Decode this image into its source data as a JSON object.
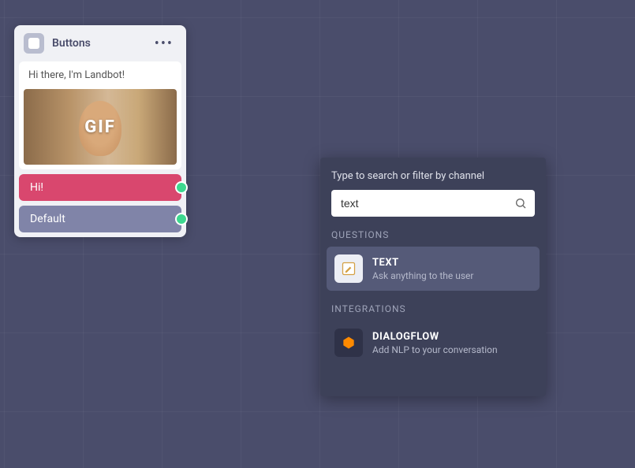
{
  "node": {
    "title": "Buttons",
    "message": "Hi there, I'm Landbot!",
    "gif_label": "GIF",
    "options": [
      {
        "label": "Hi!",
        "style": "pink"
      },
      {
        "label": "Default",
        "style": "purple"
      }
    ]
  },
  "panel": {
    "prompt": "Type to search or filter by channel",
    "search_value": "text",
    "sections": [
      {
        "label": "QUESTIONS",
        "items": [
          {
            "title": "TEXT",
            "desc": "Ask anything to the user",
            "icon": "note-pencil-icon",
            "highlighted": true
          }
        ]
      },
      {
        "label": "INTEGRATIONS",
        "items": [
          {
            "title": "DIALOGFLOW",
            "desc": "Add NLP to your conversation",
            "icon": "dialogflow-icon",
            "highlighted": false
          }
        ]
      }
    ]
  }
}
